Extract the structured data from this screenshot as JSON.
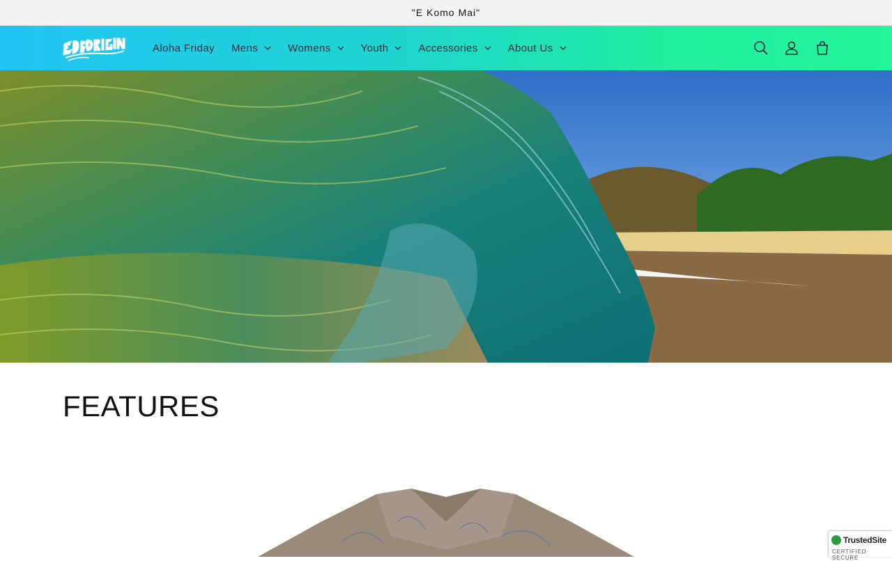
{
  "announcement": {
    "text": "\"E Komo Mai\""
  },
  "header": {
    "logo_text": "ED OUR ORIGINAL",
    "nav": [
      {
        "label": "Aloha Friday",
        "has_dropdown": false
      },
      {
        "label": "Mens",
        "has_dropdown": true
      },
      {
        "label": "Womens",
        "has_dropdown": true
      },
      {
        "label": "Youth",
        "has_dropdown": true
      },
      {
        "label": "Accessories",
        "has_dropdown": true
      },
      {
        "label": "About Us",
        "has_dropdown": true
      }
    ],
    "icons": [
      "search-icon",
      "account-icon",
      "cart-icon"
    ],
    "gradient": [
      "#21c4f5",
      "#22f59a"
    ]
  },
  "features": {
    "title": "FEATURES"
  },
  "trusted_badge": {
    "title": "TrustedSite",
    "subtitle": "CERTIFIED SECURE"
  }
}
